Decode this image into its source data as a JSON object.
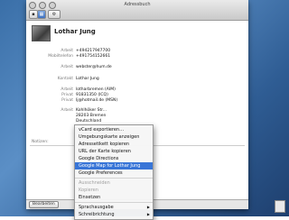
{
  "window": {
    "title": "Adressbuch"
  },
  "toolbar": {
    "view1": "▪",
    "view2": "▦",
    "gear": "⚙"
  },
  "card": {
    "name": "Lothar Jung",
    "fields": [
      {
        "label": "Arbeit",
        "value": "+494217947700"
      },
      {
        "label": "Mobiltelefon",
        "value": "+491754152661"
      },
      {
        "label": "Arbeit",
        "value": "webster@hum.de"
      },
      {
        "label": "Kontakt",
        "value": "Lothar Jung"
      },
      {
        "label": "Arbeit",
        "value": "lotharbremen (AIM)"
      },
      {
        "label": "Privat",
        "value": "91831350 (ICQ)"
      },
      {
        "label": "Privat",
        "value": "lj@hotmail.de (MSN)"
      },
      {
        "label": "Arbeit",
        "value": "Kohlhöker Str..."
      },
      {
        "label": "",
        "value": "28203 Bremen"
      },
      {
        "label": "",
        "value": "Deutschland"
      }
    ],
    "notes_label": "Notizen:"
  },
  "bottom": {
    "edit_label": "Bearbeiten"
  },
  "context_menu": {
    "items": [
      {
        "label": "vCard exportieren…",
        "state": "normal"
      },
      {
        "label": "Umgebungskarte anzeigen",
        "state": "normal"
      },
      {
        "label": "Adressetikett kopieren",
        "state": "normal"
      },
      {
        "label": "URL der Karte kopieren",
        "state": "normal"
      },
      {
        "label": "Google Directions",
        "state": "normal"
      },
      {
        "label": "Google Map for Lothar Jung",
        "state": "highlighted"
      },
      {
        "label": "Google Preferences",
        "state": "normal"
      },
      {
        "label": "Ausschneiden",
        "state": "disabled"
      },
      {
        "label": "Kopieren",
        "state": "disabled"
      },
      {
        "label": "Einsetzen",
        "state": "normal"
      },
      {
        "label": "Sprachausgabe",
        "state": "submenu"
      },
      {
        "label": "Schreibrichtung",
        "state": "submenu"
      }
    ]
  }
}
